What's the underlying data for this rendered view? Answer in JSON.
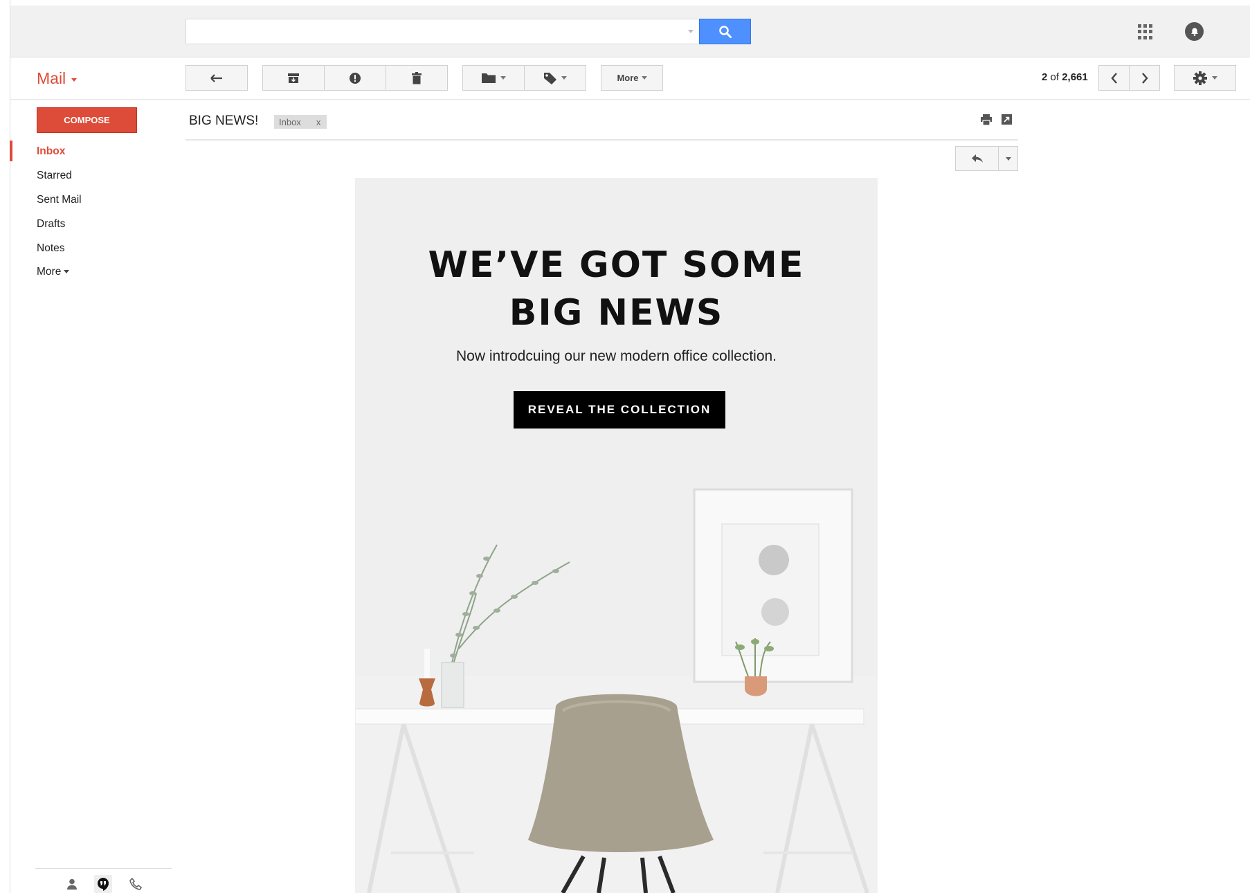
{
  "search": {
    "placeholder": "",
    "button_icon": "search-icon"
  },
  "header_icons": [
    "apps-grid-icon",
    "notifications-icon"
  ],
  "app": {
    "title": "Mail"
  },
  "toolbar": {
    "back_icon": "back-arrow-icon",
    "archive_icon": "archive-icon",
    "spam_icon": "report-spam-icon",
    "delete_icon": "trash-icon",
    "move_icon": "folder-icon",
    "labels_icon": "label-tag-icon",
    "more_label": "More",
    "pagination": {
      "current": "2",
      "of": "of",
      "total": "2,661"
    },
    "settings_icon": "gear-icon"
  },
  "sidebar": {
    "compose_label": "COMPOSE",
    "items": [
      {
        "label": "Inbox",
        "active": true
      },
      {
        "label": "Starred"
      },
      {
        "label": "Sent Mail"
      },
      {
        "label": "Drafts"
      },
      {
        "label": "Notes"
      },
      {
        "label": "More"
      }
    ],
    "bottom_icons": [
      "contacts-icon",
      "hangouts-icon",
      "phone-icon"
    ]
  },
  "message": {
    "subject": "BIG NEWS!",
    "label_chip": "Inbox",
    "label_remove": "x",
    "print_icon": "print-icon",
    "new_window_icon": "new-window-icon",
    "reply_icon": "reply-icon"
  },
  "email": {
    "headline_line1": "WE’VE GOT SOME",
    "headline_line2": "BIG NEWS",
    "subheadline": "Now introdcuing our new modern office collection.",
    "cta_label": "REVEAL THE COLLECTION"
  },
  "colors": {
    "brand_red": "#dd4b39",
    "search_blue": "#4d90fe",
    "cta_black": "#000000",
    "chair": "#a8a08e"
  }
}
